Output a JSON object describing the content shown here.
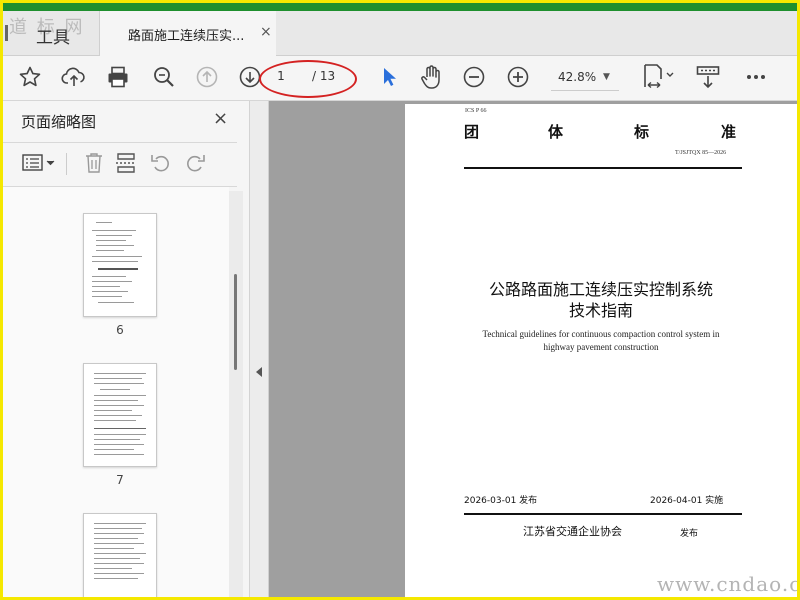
{
  "watermark_top": "道 标 网",
  "tabs": {
    "tools_label": "工具",
    "doc_label": "路面施工连续压实...",
    "close_glyph": "×"
  },
  "toolbar": {
    "page_current": "1",
    "page_total": "/ 13",
    "zoom": "42.8%",
    "icons": [
      "star-icon",
      "cloud-upload-icon",
      "print-icon",
      "zoom-search-icon",
      "prev-page-icon",
      "next-page-icon",
      "select-cursor-icon",
      "hand-tool-icon",
      "zoom-out-icon",
      "zoom-in-icon",
      "page-fit-icon",
      "read-mode-icon",
      "more-icon"
    ]
  },
  "panel": {
    "title": "页面缩略图",
    "close_glyph": "×",
    "thumbnails": [
      {
        "label": "6"
      },
      {
        "label": "7"
      },
      {
        "label": ""
      }
    ]
  },
  "document": {
    "ics": "ICS P 66",
    "standard_type_chars": [
      "团",
      "体",
      "标",
      "准"
    ],
    "standard_no": "T/JSJTQX 85—2026",
    "title_cn_line1": "公路路面施工连续压实控制系统",
    "title_cn_line2": "技术指南",
    "title_en_line1": "Technical guidelines for continuous compaction control system in",
    "title_en_line2": "highway pavement construction",
    "release_date": "2026-03-01 发布",
    "effective_date": "2026-04-01 实施",
    "issuer": "江苏省交通企业协会",
    "issued_word": "发布"
  },
  "site_watermark": "www.cndao.com",
  "colors": {
    "frame": "#f5e800",
    "titlebar": "#1e8f2e",
    "annotation": "#d42222",
    "cursor": "#2a6fdb"
  }
}
